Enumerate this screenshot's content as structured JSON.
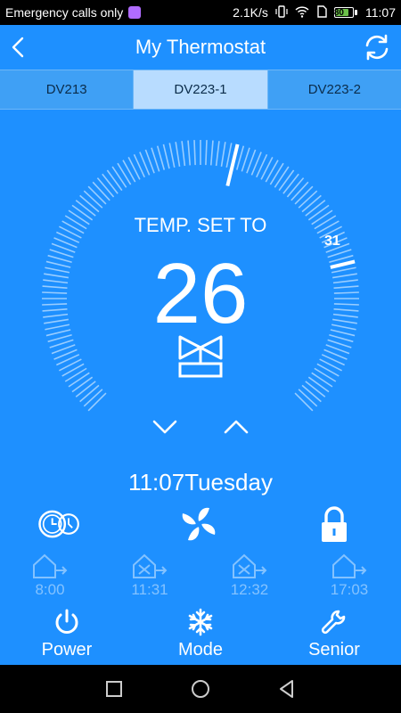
{
  "status": {
    "carrier": "Emergency calls only",
    "speed": "2.1K/s",
    "battery": "80",
    "time": "11:07"
  },
  "header": {
    "title": "My Thermostat"
  },
  "tabs": [
    {
      "label": "DV213",
      "active": false
    },
    {
      "label": "DV223-1",
      "active": true
    },
    {
      "label": "DV223-2",
      "active": false
    }
  ],
  "dial": {
    "label": "TEMP. SET TO",
    "value": "26",
    "max_label": "31",
    "level": 0.55
  },
  "clock": {
    "text": "11:07Tuesday"
  },
  "schedule": [
    {
      "time": "8:00"
    },
    {
      "time": "11:31"
    },
    {
      "time": "12:32"
    },
    {
      "time": "17:03"
    }
  ],
  "bottom": {
    "power": "Power",
    "mode": "Mode",
    "senior": "Senior"
  },
  "colors": {
    "background": "#1e90ff",
    "tab_active": "#b8dcff"
  }
}
